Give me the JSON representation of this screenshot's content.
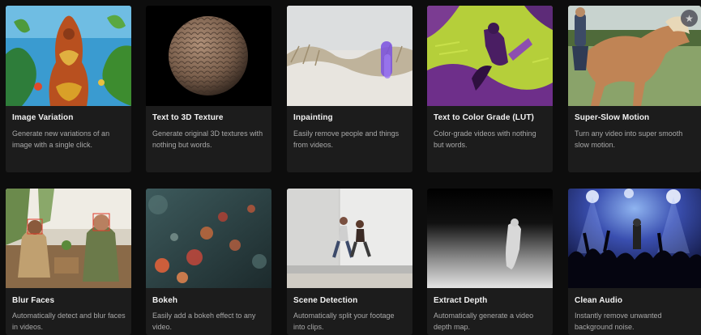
{
  "cards": [
    {
      "title": "Image Variation",
      "desc": "Generate new variations of an image with a single click.",
      "thumb_icon": "ornate-tower-thumbnail"
    },
    {
      "title": "Text to 3D Texture",
      "desc": "Generate original 3D textures with nothing but words.",
      "thumb_icon": "textured-sphere-thumbnail"
    },
    {
      "title": "Inpainting",
      "desc": "Easily remove people and things from videos.",
      "thumb_icon": "dunes-inpainting-thumbnail"
    },
    {
      "title": "Text to Color Grade (LUT)",
      "desc": "Color-grade videos with nothing but words.",
      "thumb_icon": "color-graded-rider-thumbnail"
    },
    {
      "title": "Super-Slow Motion",
      "desc": "Turn any video into super smooth slow motion.",
      "thumb_icon": "horse-rider-thumbnail"
    },
    {
      "title": "Blur Faces",
      "desc": "Automatically detect and blur faces in videos.",
      "thumb_icon": "people-seated-thumbnail"
    },
    {
      "title": "Bokeh",
      "desc": "Easily add a bokeh effect to any video.",
      "thumb_icon": "bokeh-lights-thumbnail"
    },
    {
      "title": "Scene Detection",
      "desc": "Automatically split your footage into clips.",
      "thumb_icon": "running-people-thumbnail"
    },
    {
      "title": "Extract Depth",
      "desc": "Automatically generate a video depth map.",
      "thumb_icon": "depth-map-thumbnail"
    },
    {
      "title": "Clean Audio",
      "desc": "Instantly remove unwanted background noise.",
      "thumb_icon": "concert-crowd-thumbnail"
    }
  ],
  "badge_icon": "star-icon",
  "colors": {
    "background": "#0d0d0d",
    "card": "#1c1c1c",
    "title": "#f2f2f2",
    "description": "#a9a9a9"
  }
}
